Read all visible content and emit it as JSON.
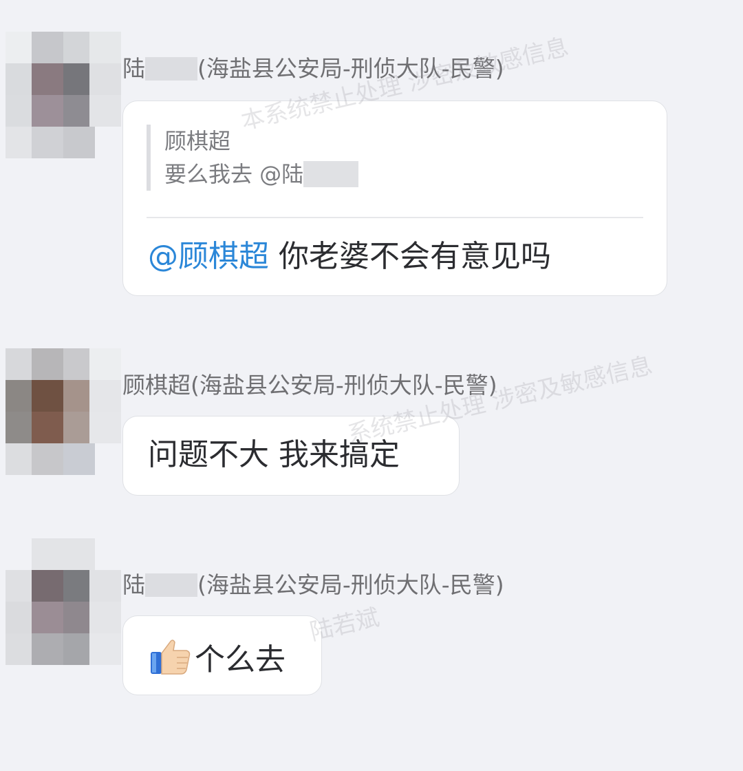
{
  "messages": [
    {
      "sender_prefix": "陆",
      "sender_suffix": "(海盐县公安局-刑侦大队-民警)",
      "quote": {
        "author": "顾棋超",
        "text_prefix": "要么我去 @陆"
      },
      "mention": "@顾棋超",
      "text": " 你老婆不会有意见吗"
    },
    {
      "sender": "顾棋超(海盐县公安局-刑侦大队-民警)",
      "text": "问题不大 我来搞定"
    },
    {
      "sender_prefix": "陆",
      "sender_suffix": "(海盐县公安局-刑侦大队-民警)",
      "emoji": "thumbs-up",
      "text": "个么去"
    }
  ],
  "watermarks": [
    "本系统禁止处理 涉密及敏感信息",
    "系统禁止处理 涉密及敏感信息",
    "陆若斌"
  ],
  "colors": {
    "background": "#f1f2f6",
    "mention": "#2b87d8",
    "bubble": "#ffffff"
  }
}
